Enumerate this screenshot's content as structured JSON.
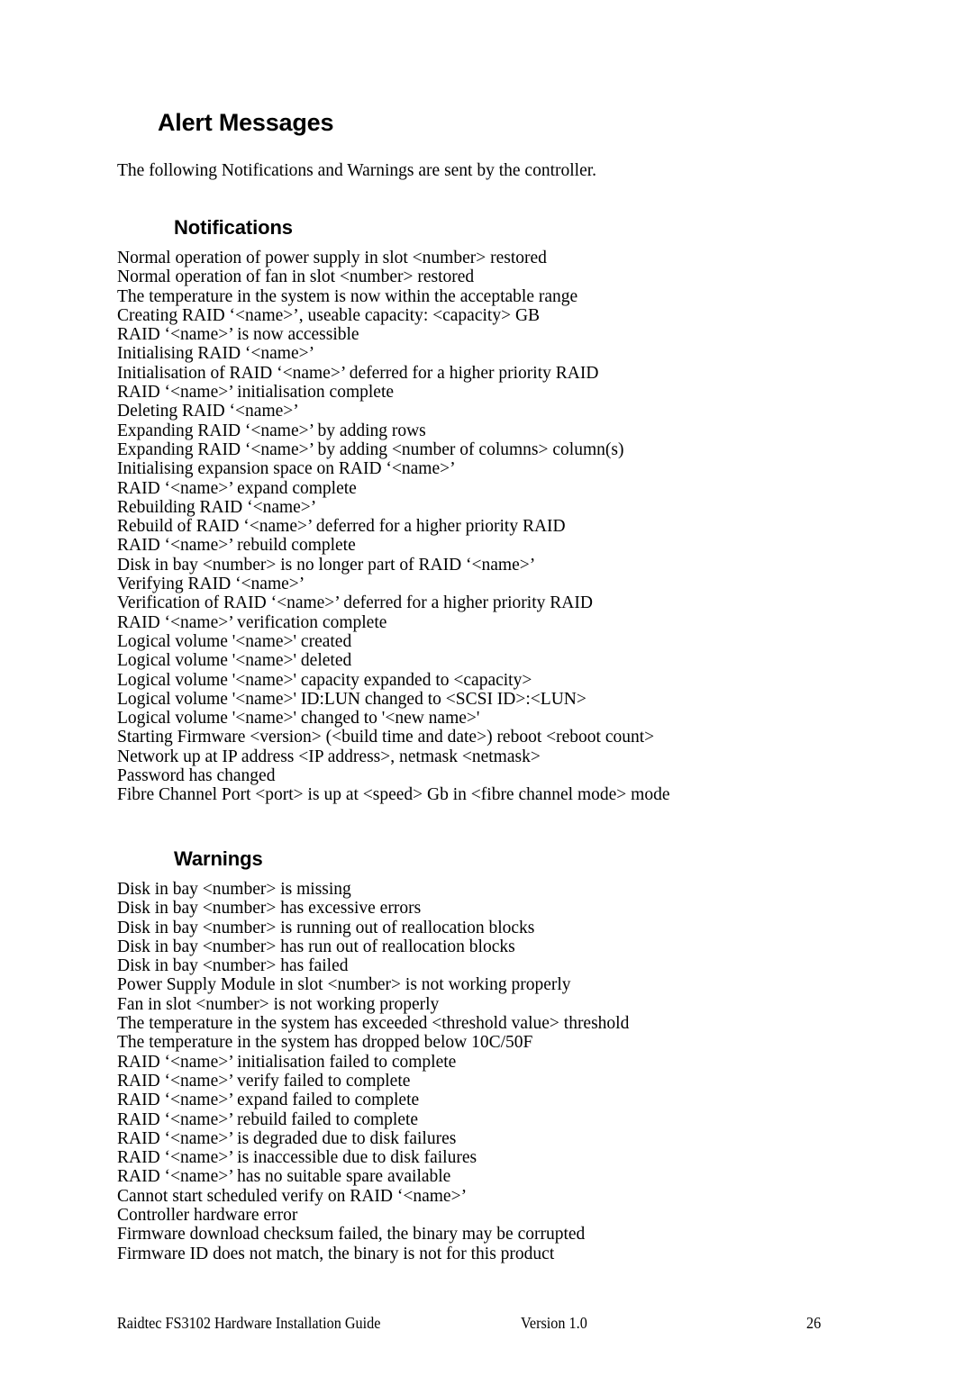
{
  "document": {
    "title": "Alert Messages",
    "intro": "The following Notifications and Warnings are sent by the controller."
  },
  "notifications": {
    "heading": "Notifications",
    "items": [
      "Normal operation of power supply in slot <number> restored",
      "Normal operation of fan in slot <number> restored",
      "The temperature in the system is now within the acceptable range",
      "Creating RAID ‘<name>’, useable capacity: <capacity> GB",
      "RAID ‘<name>’ is now accessible",
      "Initialising RAID ‘<name>’",
      "Initialisation of RAID ‘<name>’ deferred for a higher priority RAID",
      "RAID ‘<name>’ initialisation complete",
      "Deleting RAID ‘<name>’",
      "Expanding RAID ‘<name>’ by adding rows",
      "Expanding RAID ‘<name>’ by adding <number of columns> column(s)",
      "Initialising expansion space on RAID ‘<name>’",
      "RAID ‘<name>’ expand complete",
      "Rebuilding RAID ‘<name>’",
      "Rebuild of RAID ‘<name>’ deferred for a higher priority RAID",
      "RAID ‘<name>’ rebuild complete",
      "Disk in bay <number> is no longer part of RAID ‘<name>’",
      "Verifying RAID ‘<name>’",
      "Verification of RAID ‘<name>’ deferred for a higher priority RAID",
      "RAID ‘<name>’ verification complete",
      "Logical volume '<name>' created",
      "Logical volume '<name>' deleted",
      "Logical volume '<name>' capacity expanded to <capacity>",
      "Logical volume '<name>' ID:LUN changed to <SCSI ID>:<LUN>",
      "Logical volume '<name>' changed to '<new name>'",
      "Starting Firmware <version> (<build time and date>) reboot <reboot count>",
      "Network up at IP address <IP address>, netmask <netmask>",
      "Password has changed",
      "Fibre Channel Port <port> is up at <speed> Gb in <fibre channel mode> mode"
    ]
  },
  "warnings": {
    "heading": "Warnings",
    "items": [
      "Disk in bay <number> is missing",
      "Disk in bay <number> has excessive errors",
      "Disk in bay <number> is running out of reallocation blocks",
      "Disk in bay <number> has run out of reallocation blocks",
      "Disk in bay <number> has failed",
      "Power Supply Module in slot <number> is not working properly",
      "Fan in slot <number> is not working properly",
      "The temperature in the system has exceeded <threshold value> threshold",
      "The temperature in the system has dropped below 10C/50F",
      "RAID ‘<name>’ initialisation failed to complete",
      "RAID ‘<name>’ verify failed to complete",
      "RAID ‘<name>’ expand failed to complete",
      "RAID ‘<name>’ rebuild failed to complete",
      "RAID ‘<name>’ is degraded due to disk failures",
      "RAID ‘<name>’ is inaccessible due to disk failures",
      "RAID ‘<name>’ has no suitable spare available",
      "Cannot start scheduled verify on RAID ‘<name>’",
      "Controller hardware error",
      "Firmware download checksum failed, the binary may be corrupted",
      "Firmware ID does not match, the binary is not for this product"
    ]
  },
  "footer": {
    "left": "Raidtec FS3102 Hardware Installation Guide",
    "center": "Version 1.0",
    "page_number": "26"
  }
}
